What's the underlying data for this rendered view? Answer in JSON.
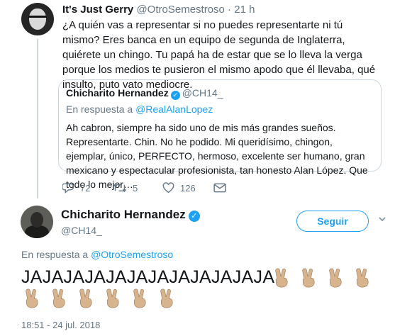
{
  "tweet1": {
    "name": "It's Just Gerry",
    "handle": "@OtroSemestroso",
    "separator": " · ",
    "time": "21 h",
    "text": "¿A quién vas a representar si no puedes representarte ni tú mismo? Eres banca en un equipo de segunda de Inglaterra, quiérete un chingo. Tu papá ha de estar que se lo lleva la verga porque los medios te pusieron el mismo apodo que él llevaba, qué insulto, puto vato mediocre.",
    "quote": {
      "name": "Chicharito Hernandez",
      "verified_icon": "verified-badge-icon",
      "handle": "@CH14_",
      "reply_prefix": "En respuesta a ",
      "reply_to": "@RealAlanLopez",
      "text": "Ah cabron, siempre ha sido uno de mis más grandes sueños. Representarte. Chin. No he podido. Mi queridísimo, chingon, ejemplar, único, PERFECTO, hermoso, excelente ser humano, gran mexicano y espectacular profesionista, tan honesto Alan López. Que todo lo mejor…"
    },
    "actions": {
      "replies": "72",
      "retweets": "5",
      "likes": "126",
      "reply_icon": "reply-icon",
      "retweet_icon": "retweet-icon",
      "like_icon": "heart-icon",
      "dm_icon": "envelope-icon"
    }
  },
  "main_tweet": {
    "name": "Chicharito Hernandez",
    "handle": "@CH14_",
    "follow_label": "Seguir",
    "reply_prefix": "En respuesta a ",
    "reply_to": "@OtroSemestroso",
    "text": "JAJAJAJAJAJAJAJAJAJAJAJA",
    "emoji": "victory-hand-emoji",
    "emoji_count": 10,
    "timestamp": "18:51 - 24 jul. 2018"
  },
  "colors": {
    "link": "#1da1f2",
    "muted": "#657786",
    "text": "#14171a",
    "border": "#ccd6dd",
    "emoji_skin": "#d7b48e"
  }
}
